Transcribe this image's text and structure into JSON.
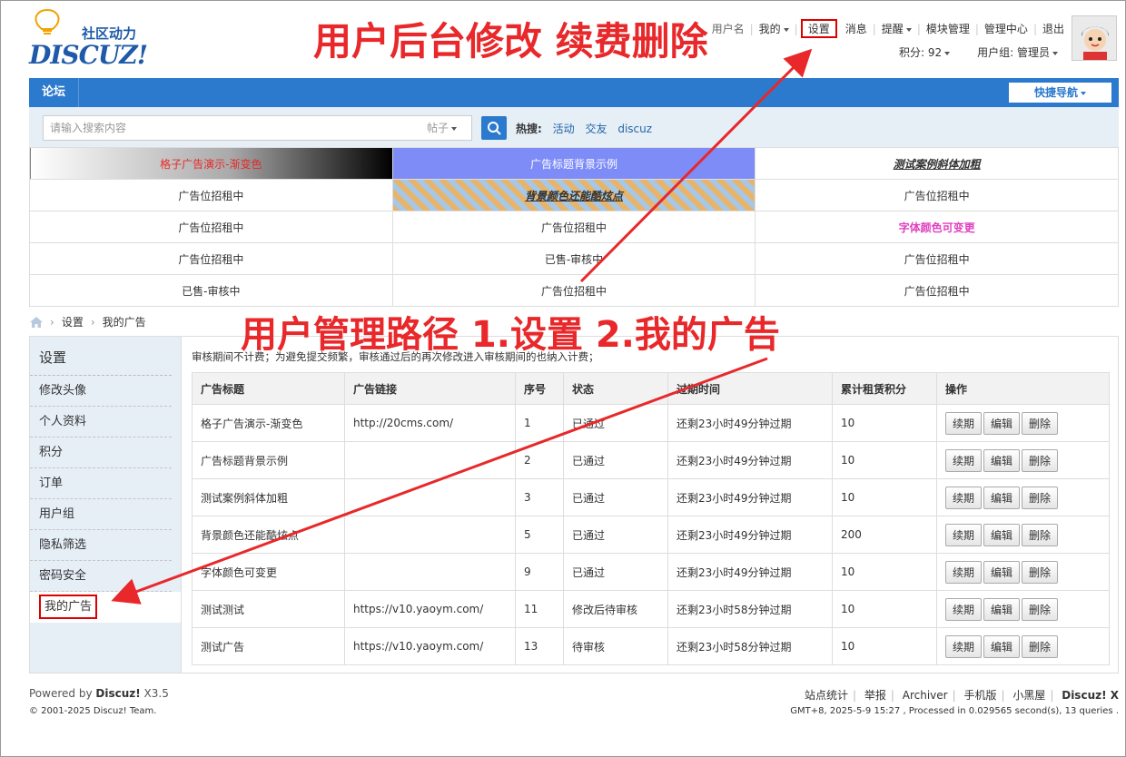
{
  "logo": {
    "tagline": "社区动力",
    "wordmark": "DISCUZ!"
  },
  "annotations": {
    "top_title": "用户后台修改  续费删除",
    "path_title": "用户管理路径  1.设置   2.我的广告"
  },
  "topnav": {
    "partial": "用户名",
    "mine": "我的",
    "settings": "设置",
    "messages": "消息",
    "reminders": "提醒",
    "module_admin": "模块管理",
    "admin_center": "管理中心",
    "logout": "退出",
    "points": "积分: 92",
    "usergroup": "用户组: 管理员"
  },
  "navbar": {
    "forum": "论坛",
    "quick_nav": "快捷导航"
  },
  "search": {
    "placeholder": "请输入搜索内容",
    "type": "帖子",
    "hot_label": "热搜:",
    "hot": [
      "活动",
      "交友",
      "discuz"
    ]
  },
  "ad_grid": [
    [
      "格子广告演示-渐变色",
      "广告标题背景示例",
      "测试案例斜体加粗"
    ],
    [
      "广告位招租中",
      "背景颜色还能酷炫点",
      "广告位招租中"
    ],
    [
      "广告位招租中",
      "广告位招租中",
      "字体颜色可变更"
    ],
    [
      "广告位招租中",
      "已售-审核中",
      "广告位招租中"
    ],
    [
      "已售-审核中",
      "广告位招租中",
      "广告位招租中"
    ]
  ],
  "breadcrumb": {
    "level1": "设置",
    "level2": "我的广告"
  },
  "sidebar": {
    "title": "设置",
    "items": [
      "修改头像",
      "个人资料",
      "积分",
      "订单",
      "用户组",
      "隐私筛选",
      "密码安全",
      "我的广告"
    ]
  },
  "notice": "审核期间不计费；为避免提交频繁，审核通过后的再次修改进入审核期间的也纳入计费；",
  "table": {
    "headers": [
      "广告标题",
      "广告链接",
      "序号",
      "状态",
      "过期时间",
      "累计租赁积分",
      "操作"
    ],
    "actions": [
      "续期",
      "编辑",
      "删除"
    ],
    "rows": [
      [
        "格子广告演示-渐变色",
        "http://20cms.com/",
        "1",
        "已通过",
        "还剩23小时49分钟过期",
        "10"
      ],
      [
        "广告标题背景示例",
        "",
        "2",
        "已通过",
        "还剩23小时49分钟过期",
        "10"
      ],
      [
        "测试案例斜体加粗",
        "",
        "3",
        "已通过",
        "还剩23小时49分钟过期",
        "10"
      ],
      [
        "背景颜色还能酷炫点",
        "",
        "5",
        "已通过",
        "还剩23小时49分钟过期",
        "200"
      ],
      [
        "字体颜色可变更",
        "",
        "9",
        "已通过",
        "还剩23小时49分钟过期",
        "10"
      ],
      [
        "测试测试",
        "https://v10.yaoym.com/",
        "11",
        "修改后待审核",
        "还剩23小时58分钟过期",
        "10"
      ],
      [
        "测试广告",
        "https://v10.yaoym.com/",
        "13",
        "待审核",
        "还剩23小时58分钟过期",
        "10"
      ]
    ]
  },
  "footer": {
    "powered_prefix": "Powered by ",
    "powered_brand": "Discuz!",
    "powered_version": " X3.5",
    "copyright": "© 2001-2025 Discuz! Team.",
    "links": [
      "站点统计",
      "举报",
      "Archiver",
      "手机版",
      "小黑屋"
    ],
    "brand_right": "Discuz! X",
    "stats": "GMT+8, 2025-5-9 15:27 , Processed in 0.029565 second(s), 13 queries ."
  },
  "colors": {
    "primary": "#2b7acd",
    "annotation": "#e8282a",
    "highlight_box": "#dd0000"
  }
}
